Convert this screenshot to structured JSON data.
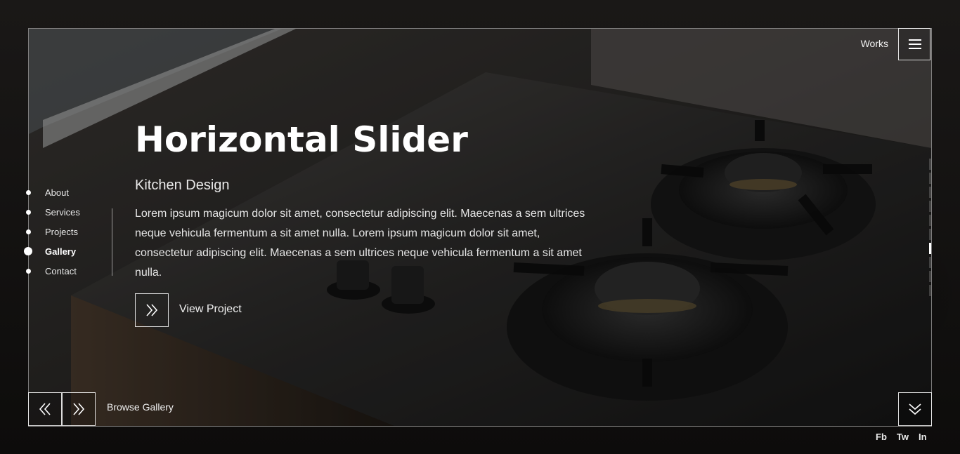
{
  "header": {
    "works_label": "Works",
    "menu_icon": "hamburger-icon"
  },
  "dotnav": {
    "items": [
      {
        "label": "About",
        "active": false
      },
      {
        "label": "Services",
        "active": false
      },
      {
        "label": "Projects",
        "active": false
      },
      {
        "label": "Gallery",
        "active": true
      },
      {
        "label": "Contact",
        "active": false
      }
    ]
  },
  "slide": {
    "title": "Horizontal Slider",
    "subtitle": "Kitchen Design",
    "description": "Lorem ipsum magicum dolor sit amet, consectetur adipiscing elit. Maecenas a sem ultrices neque vehicula fermentum a sit amet nulla. Lorem ipsum magicum dolor sit amet, consectetur adipiscing elit. Maecenas a sem ultrices neque vehicula fermentum a sit amet nulla.",
    "view_label": "View Project",
    "view_icon": "double-chevron-right-icon"
  },
  "footer": {
    "browse_label": "Browse Gallery",
    "prev_icon": "double-chevron-left-icon",
    "next_icon": "double-chevron-right-icon",
    "down_icon": "double-chevron-down-icon"
  },
  "social": {
    "items": [
      "Fb",
      "Tw",
      "In"
    ]
  },
  "colors": {
    "text": "#ffffff",
    "border": "#ffffff",
    "background": "#0b0a09"
  }
}
